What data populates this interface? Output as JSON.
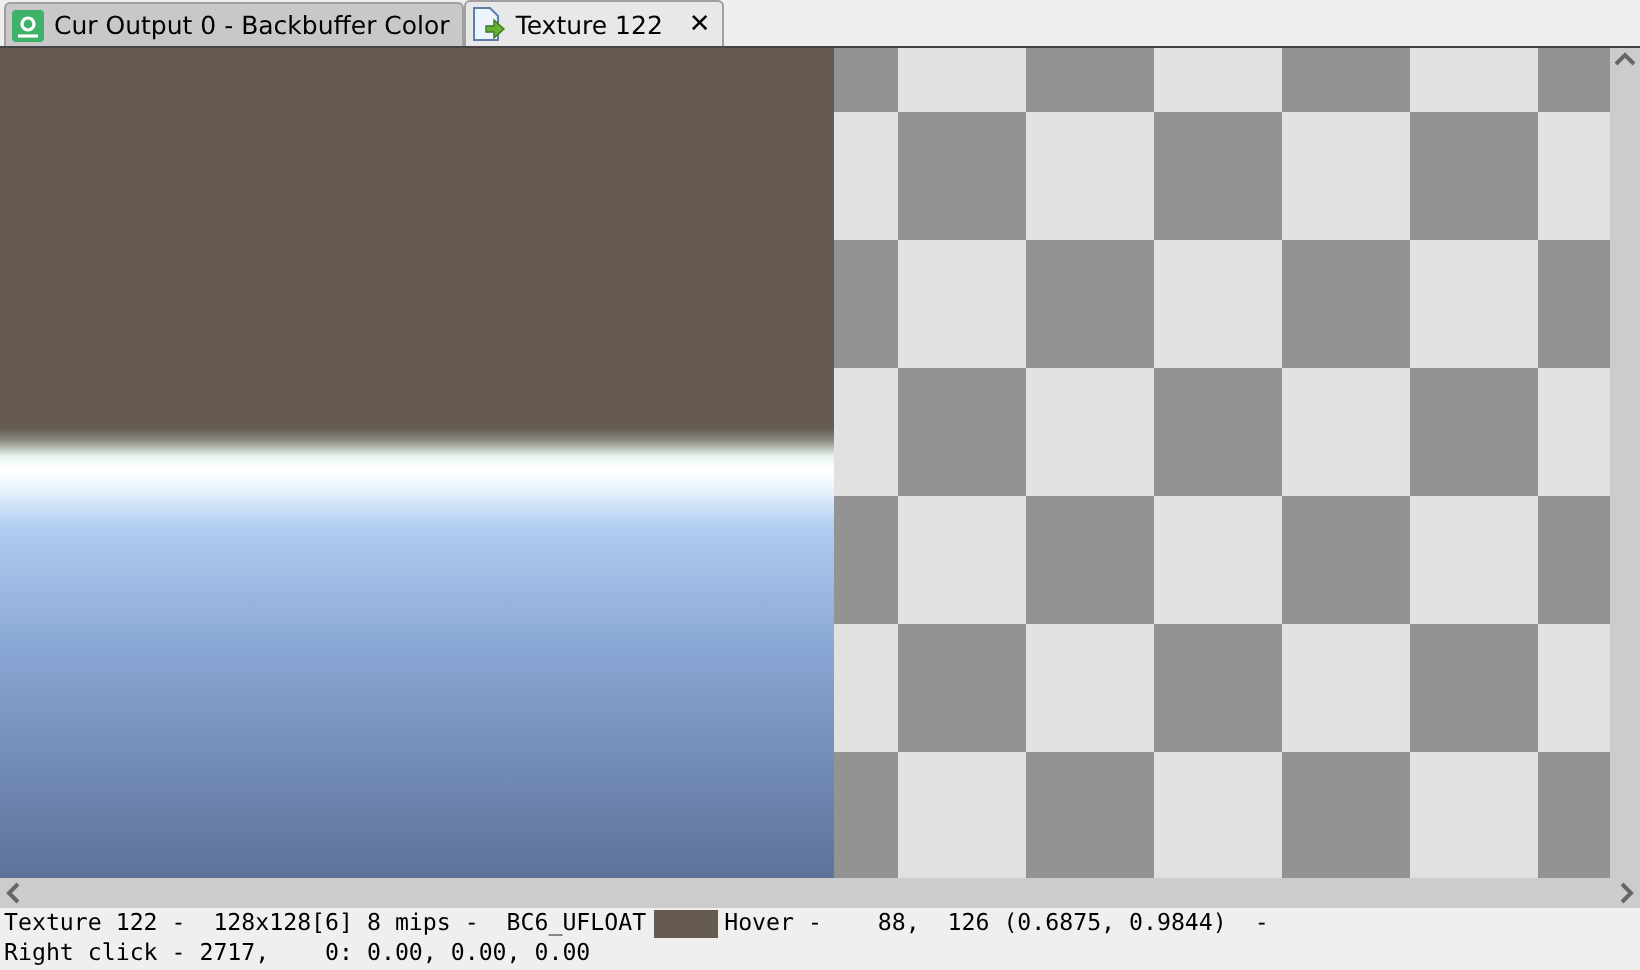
{
  "tabs": [
    {
      "label": "Cur Output 0 - Backbuffer Color",
      "selected": false,
      "closable": false,
      "kind": "output"
    },
    {
      "label": "Texture 122",
      "selected": true,
      "closable": true,
      "kind": "texture"
    }
  ],
  "close_glyph": "✕",
  "status": {
    "info": "Texture 122 -  128x128[6] 8 mips -  BC6_UFLOAT",
    "swatch": {
      "color": "#655b50"
    },
    "hover": "Hover -    88,  126 (0.6875, 0.9844)  -",
    "right_click": "Right click - 2717,    0: 0.00, 0.00, 0.00"
  }
}
